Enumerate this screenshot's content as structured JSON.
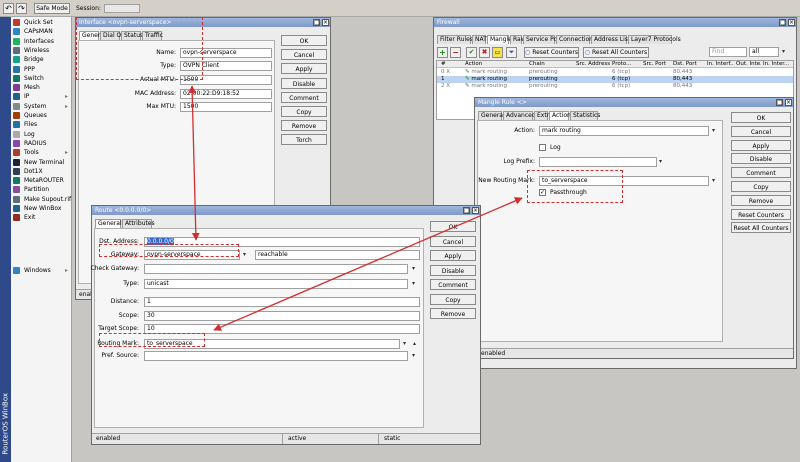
{
  "toolbar": {
    "undo": "↶",
    "redo": "↷",
    "safe_mode": "Safe Mode",
    "session_label": "Session:"
  },
  "sidebar": {
    "vertical_title": "RouterOS WinBox",
    "items": [
      {
        "label": "Quick Set",
        "icon": "quickset-icon",
        "color": "#c0392b"
      },
      {
        "label": "CAPsMAN",
        "icon": "capsman-icon",
        "color": "#2e86c1"
      },
      {
        "label": "Interfaces",
        "icon": "interfaces-icon",
        "color": "#27ae60"
      },
      {
        "label": "Wireless",
        "icon": "wireless-icon",
        "color": "#5d6d7e"
      },
      {
        "label": "Bridge",
        "icon": "bridge-icon",
        "color": "#16a085"
      },
      {
        "label": "PPP",
        "icon": "ppp-icon",
        "color": "#2874a6"
      },
      {
        "label": "Switch",
        "icon": "switch-icon",
        "color": "#117864"
      },
      {
        "label": "Mesh",
        "icon": "mesh-icon",
        "color": "#7d3c98"
      },
      {
        "label": "IP",
        "icon": "ip-icon",
        "color": "#1f618d",
        "arrow": "▸"
      },
      {
        "label": "System",
        "icon": "system-icon",
        "color": "#7f8c8d",
        "arrow": "▸"
      },
      {
        "label": "Queues",
        "icon": "queues-icon",
        "color": "#a04000"
      },
      {
        "label": "Files",
        "icon": "files-icon",
        "color": "#2471a3"
      },
      {
        "label": "Log",
        "icon": "log-icon",
        "color": "#aaaaaa"
      },
      {
        "label": "RADIUS",
        "icon": "radius-icon",
        "color": "#8e44ad"
      },
      {
        "label": "Tools",
        "icon": "tools-icon",
        "color": "#b03a2e",
        "arrow": "▸"
      },
      {
        "label": "New Terminal",
        "icon": "terminal-icon",
        "color": "#1b2631"
      },
      {
        "label": "Dot1X",
        "icon": "dot1x-icon",
        "color": "#2e4053"
      },
      {
        "label": "MetaROUTER",
        "icon": "metarouter-icon",
        "color": "#117a65"
      },
      {
        "label": "Partition",
        "icon": "partition-icon",
        "color": "#884ea0"
      },
      {
        "label": "Make Supout.rif",
        "icon": "supout-icon",
        "color": "#5d6d7e"
      },
      {
        "label": "New WinBox",
        "icon": "winbox-icon",
        "color": "#21618c"
      },
      {
        "label": "Exit",
        "icon": "exit-icon",
        "color": "#922b21"
      },
      {
        "label": "Windows",
        "icon": "windows-icon",
        "color": "#2e86c1",
        "arrow": "▸"
      }
    ]
  },
  "iface_win": {
    "title": "Interface <ovpn-serverspace>",
    "tabs": [
      "General",
      "Dial Out",
      "Status",
      "Traffic"
    ],
    "name_label": "Name:",
    "name": "ovpn-serverspace",
    "type_label": "Type:",
    "type": "OVPN Client",
    "actual_mtu_label": "Actual MTU:",
    "actual_mtu": "1500",
    "mac_label": "MAC Address:",
    "mac": "02:00:22:D9:18:52",
    "maxmtu_label": "Max MTU:",
    "maxmtu": "1500",
    "buttons": [
      "OK",
      "Cancel",
      "Apply",
      "Disable",
      "Comment",
      "Copy",
      "Remove",
      "Torch"
    ],
    "status": "enabled"
  },
  "firewall_win": {
    "title": "Firewall",
    "tabs": [
      "Filter Rules",
      "NAT",
      "Mangle",
      "Raw",
      "Service Ports",
      "Connections",
      "Address Lists",
      "Layer7 Protocols"
    ],
    "reset_counters": "Reset Counters",
    "reset_all_counters": "Reset All Counters",
    "find_placeholder": "Find",
    "chain_filter": "all",
    "columns": [
      "#",
      "Action",
      "Chain",
      "Src. Address",
      "Proto...",
      "Src. Port",
      "Dst. Port",
      "In. Interf...",
      "Out. Inte...",
      "In. Inter..."
    ],
    "rows": [
      {
        "num": "0",
        "flag": "X",
        "action": "mark routing",
        "chain": "prerouting",
        "src": "",
        "proto": "6 (tcp)",
        "sport": "",
        "dport": "80,443"
      },
      {
        "num": "1",
        "flag": "",
        "action": "mark routing",
        "chain": "prerouting",
        "src": "",
        "proto": "6 (tcp)",
        "sport": "",
        "dport": "80,443"
      },
      {
        "num": "2",
        "flag": "X",
        "action": "mark routing",
        "chain": "prerouting",
        "src": "",
        "proto": "6 (tcp)",
        "sport": "",
        "dport": "80,443"
      }
    ]
  },
  "mangle_win": {
    "title": "Mangle Rule <>",
    "tabs": [
      "General",
      "Advanced",
      "Extra",
      "Action",
      "Statistics"
    ],
    "action_label": "Action:",
    "action": "mark routing",
    "log_label": "Log",
    "log_prefix_label": "Log Prefix:",
    "log_prefix": "",
    "new_mark_label": "New Routing Mark:",
    "new_mark": "to_serverspace",
    "passthrough_label": "Passthrough",
    "buttons": [
      "OK",
      "Cancel",
      "Apply",
      "Disable",
      "Comment",
      "Copy",
      "Remove",
      "Reset Counters",
      "Reset All Counters"
    ],
    "status": "enabled"
  },
  "route_win": {
    "title": "Route <0.0.0.0/0>",
    "tabs": [
      "General",
      "Attributes"
    ],
    "dst_label": "Dst. Address:",
    "dst": "0.0.0.0/0",
    "gw_label": "Gateway:",
    "gw": "ovpn-serverspace",
    "gw_state": "reachable",
    "check_gw_label": "Check Gateway:",
    "check_gw": "",
    "type_label": "Type:",
    "type": "unicast",
    "distance_label": "Distance:",
    "distance": "1",
    "scope_label": "Scope:",
    "scope": "30",
    "target_scope_label": "Target Scope:",
    "target_scope": "10",
    "routing_mark_label": "Routing Mark:",
    "routing_mark": "to_serverspace",
    "pref_source_label": "Pref. Source:",
    "pref_source": "",
    "buttons": [
      "OK",
      "Cancel",
      "Apply",
      "Disable",
      "Comment",
      "Copy",
      "Remove"
    ],
    "status_enabled": "enabled",
    "status_active": "active",
    "status_static": "static"
  },
  "colors": {
    "highlight": "#d23030",
    "title_bar": "#8aa4d4",
    "selected_row": "#bcd4f0",
    "sidebar_strip": "#2f4a8a"
  }
}
